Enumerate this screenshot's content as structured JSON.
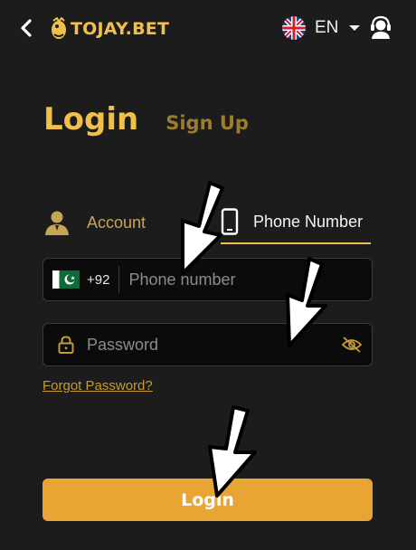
{
  "header": {
    "logo_text": "TOJAY.BET",
    "language_code": "EN"
  },
  "auth": {
    "login_tab": "Login",
    "signup_tab": "Sign Up"
  },
  "method": {
    "account_label": "Account",
    "phone_label": "Phone Number",
    "active": "Phone Number"
  },
  "phone": {
    "country_code": "+92",
    "placeholder": "Phone number",
    "value": ""
  },
  "password": {
    "placeholder": "Password",
    "value": ""
  },
  "forgot_label": "Forgot Password?",
  "login_button_label": "Login",
  "icons": {
    "back": "chevron-left-icon",
    "logo": "logo-icon",
    "flag": "uk-flag-icon",
    "dropdown": "caret-down-icon",
    "support": "support-agent-icon",
    "account": "user-icon",
    "phone": "smartphone-icon",
    "country_flag": "pakistan-flag-icon",
    "lock": "lock-icon",
    "eye": "eye-off-icon"
  },
  "colors": {
    "background": "#1c1c1c",
    "accent": "#f0c04a",
    "accent_dim": "#9a7d2e",
    "button": "#e9a534",
    "field_bg": "#0b0b0b"
  }
}
